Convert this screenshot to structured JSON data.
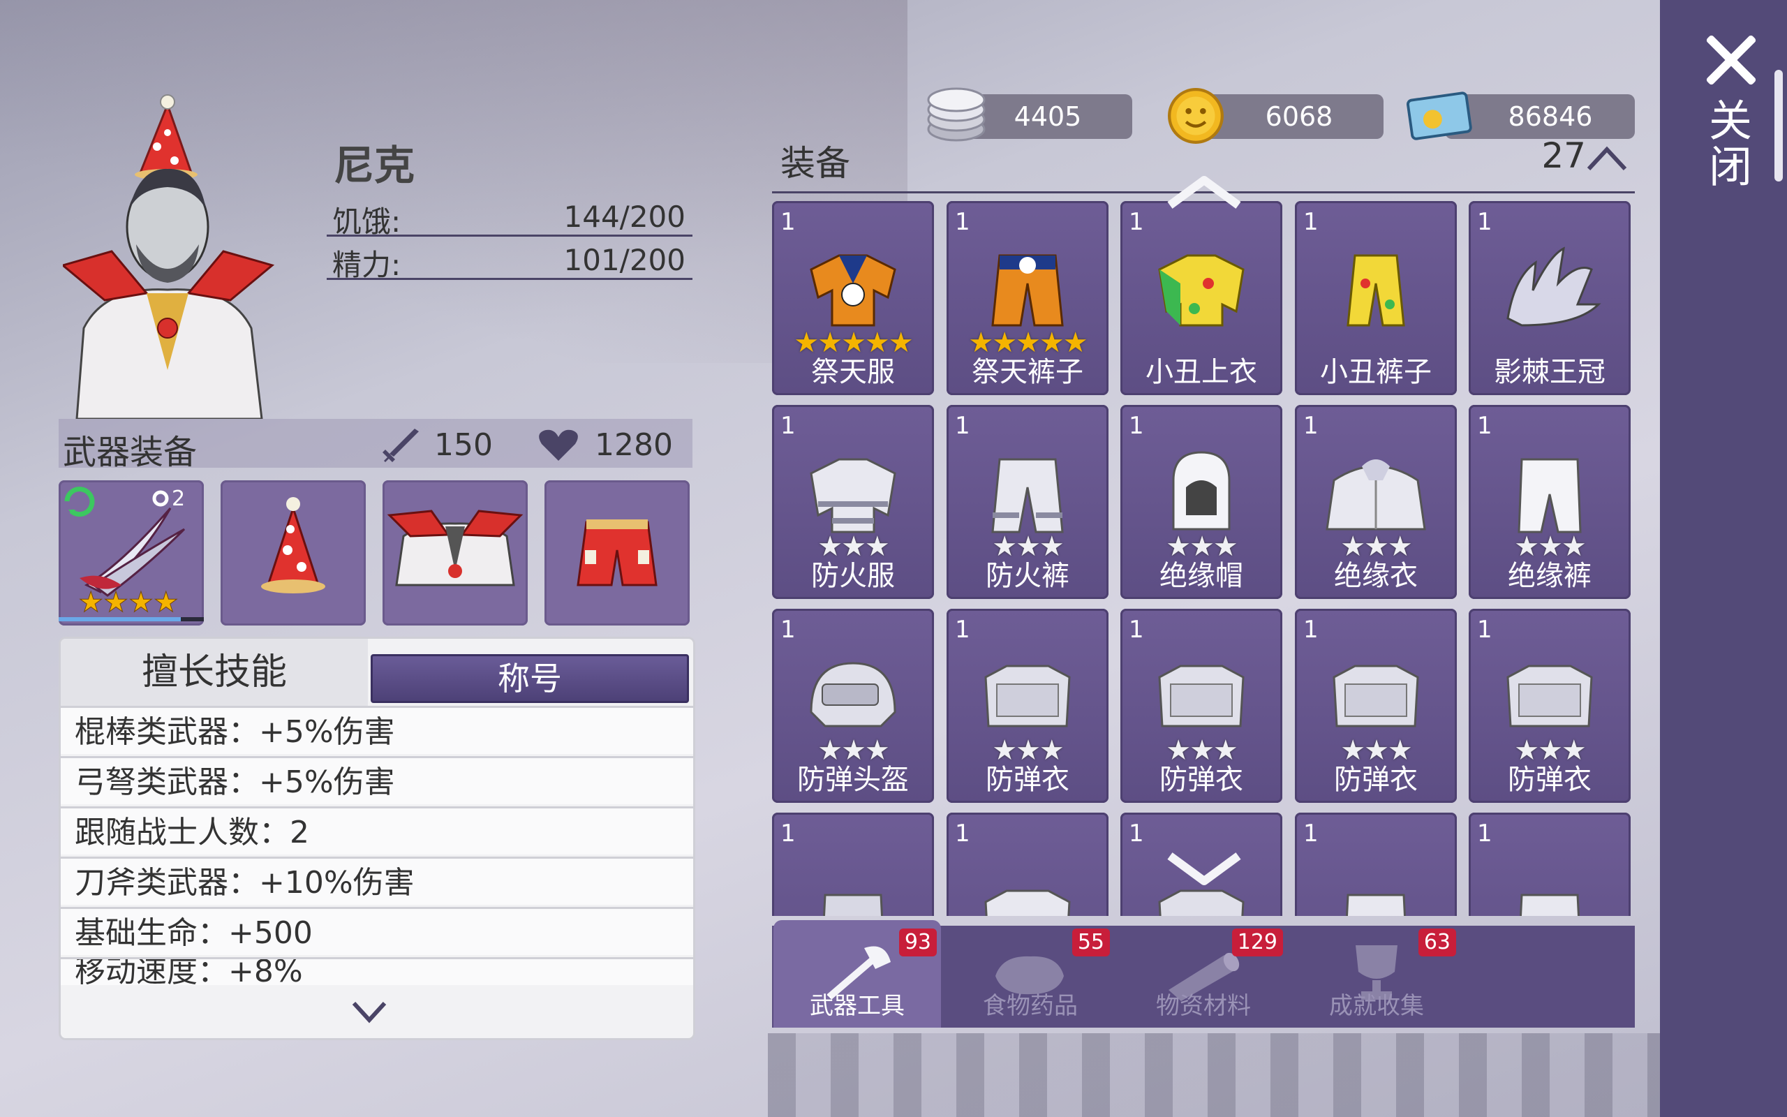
{
  "close_label": "关闭",
  "currencies": [
    {
      "name": "silver-coins",
      "value": "4405"
    },
    {
      "name": "gold-coin",
      "value": "6068"
    },
    {
      "name": "ticket",
      "value": "86846"
    }
  ],
  "character": {
    "name": "尼克",
    "hunger_label": "饥饿:",
    "hunger_value": "144/200",
    "energy_label": "精力:",
    "energy_value": "101/200"
  },
  "weapons": {
    "title": "武器装备",
    "attack": "150",
    "health": "1280",
    "slots": [
      {
        "item": "red-claw-weapon",
        "level": "2",
        "stars": "★★★★"
      },
      {
        "item": "party-hat"
      },
      {
        "item": "clown-jacket"
      },
      {
        "item": "red-shorts"
      }
    ]
  },
  "skills": {
    "tab_skill": "擅长技能",
    "tab_title": "称号",
    "rows": [
      "棍棒类武器：+5%伤害",
      "弓弩类武器：+5%伤害",
      "跟随战士人数：2",
      "刀斧类武器：+10%伤害",
      "基础生命：+500",
      "移动速度：+8%"
    ]
  },
  "inventory": {
    "label": "装备",
    "count": "27",
    "items": [
      {
        "qty": "1",
        "name": "祭天服",
        "stars": "★★★★★",
        "star_color": "gold"
      },
      {
        "qty": "1",
        "name": "祭天裤子",
        "stars": "★★★★★",
        "star_color": "gold"
      },
      {
        "qty": "1",
        "name": "小丑上衣",
        "stars": "",
        "star_color": "none"
      },
      {
        "qty": "1",
        "name": "小丑裤子",
        "stars": "",
        "star_color": "none"
      },
      {
        "qty": "1",
        "name": "影棘王冠",
        "stars": "",
        "star_color": "none"
      },
      {
        "qty": "1",
        "name": "防火服",
        "stars": "★★★",
        "star_color": "silver"
      },
      {
        "qty": "1",
        "name": "防火裤",
        "stars": "★★★",
        "star_color": "silver"
      },
      {
        "qty": "1",
        "name": "绝缘帽",
        "stars": "★★★",
        "star_color": "silver"
      },
      {
        "qty": "1",
        "name": "绝缘衣",
        "stars": "★★★",
        "star_color": "silver"
      },
      {
        "qty": "1",
        "name": "绝缘裤",
        "stars": "★★★",
        "star_color": "silver"
      },
      {
        "qty": "1",
        "name": "防弹头盔",
        "stars": "★★★",
        "star_color": "silver"
      },
      {
        "qty": "1",
        "name": "防弹衣",
        "stars": "★★★",
        "star_color": "silver"
      },
      {
        "qty": "1",
        "name": "防弹衣",
        "stars": "★★★",
        "star_color": "silver"
      },
      {
        "qty": "1",
        "name": "防弹衣",
        "stars": "★★★",
        "star_color": "silver"
      },
      {
        "qty": "1",
        "name": "防弹衣",
        "stars": "★★★",
        "star_color": "silver"
      },
      {
        "qty": "1",
        "name": "",
        "stars": "",
        "star_color": "none"
      },
      {
        "qty": "1",
        "name": "",
        "stars": "",
        "star_color": "none"
      },
      {
        "qty": "1",
        "name": "",
        "stars": "",
        "star_color": "none"
      },
      {
        "qty": "1",
        "name": "",
        "stars": "",
        "star_color": "none"
      },
      {
        "qty": "1",
        "name": "",
        "stars": "",
        "star_color": "none"
      }
    ]
  },
  "bottom_tabs": [
    {
      "label": "武器工具",
      "badge": "93",
      "icon": "axe-icon",
      "active": true
    },
    {
      "label": "食物药品",
      "badge": "55",
      "icon": "meat-icon",
      "active": false
    },
    {
      "label": "物资材料",
      "badge": "129",
      "icon": "log-icon",
      "active": false
    },
    {
      "label": "成就收集",
      "badge": "63",
      "icon": "trophy-icon",
      "active": false
    }
  ],
  "colors": {
    "panel_purple": "#534a78",
    "card_purple": "#6e5d96",
    "badge_red": "#c81e3a",
    "gold_star": "#f5b400",
    "silver_star": "#e8e8ec"
  }
}
